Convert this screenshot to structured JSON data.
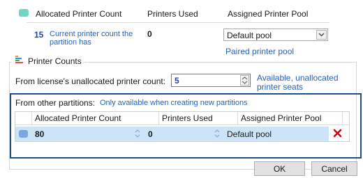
{
  "top_table": {
    "headers": {
      "allocated": "Allocated Printer Count",
      "used": "Printers Used",
      "pool": "Assigned Printer Pool"
    },
    "count_value": "15",
    "count_label": "Current printer count the partition has",
    "used_value": "0",
    "pool_select": "Default pool",
    "paired_link": "Paired printer pool"
  },
  "printer_counts": {
    "legend": "Printer Counts",
    "license_label": "From license's unallocated printer count:",
    "license_value": "5",
    "license_hint": "Available, unallocated printer seats"
  },
  "partitions": {
    "label": "From other partitions:",
    "hint": "Only available when creating new partitions",
    "columns": [
      "Allocated Printer Count",
      "Printers Used",
      "Assigned Printer Pool"
    ],
    "rows": [
      {
        "allocated": "80",
        "used": "0",
        "pool": "Default pool"
      }
    ]
  },
  "footer": {
    "ok": "OK",
    "cancel": "Cancel"
  },
  "colors": {
    "teal_swatch": "#6fd6c4",
    "selected_row": "#cde3f7",
    "delete": "#d0021b",
    "focus_border": "#1c4f86"
  }
}
